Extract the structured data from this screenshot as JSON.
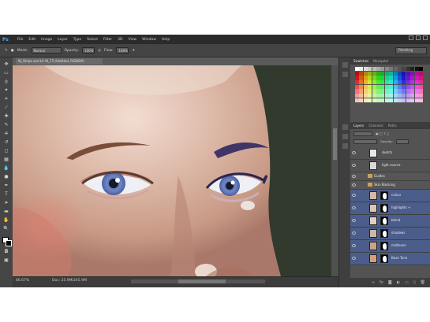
{
  "menubar": {
    "app_logo": "Ps",
    "items": [
      "File",
      "Edit",
      "Image",
      "Layer",
      "Type",
      "Select",
      "Filter",
      "3D",
      "View",
      "Window",
      "Help"
    ]
  },
  "options": {
    "mode_label": "Mode:",
    "mode_value": "Normal",
    "opacity_label": "Opacity:",
    "opacity_value": "100%",
    "flow_label": "Flow:",
    "flow_value": "100%",
    "workspace": "Painting"
  },
  "document": {
    "tab_title": "W_Stripe and Lit W_75 (Untitled, RGB/8#)",
    "zoom": "66.67%",
    "doc_size": "Doc: 25.9M/245.9M"
  },
  "right_panel": {
    "swatch_tabs": [
      "Swatches",
      "Navigator"
    ],
    "layer_tabs": [
      "Layers",
      "Channels",
      "Paths"
    ],
    "kind_label": "Kind",
    "blend_value": "Normal",
    "opacity_label": "Opacity:",
    "opacity_value": "100%",
    "fill_label": "Fill:",
    "fill_value": "100%",
    "layers": [
      {
        "name": "sketch",
        "selected": false,
        "thumb": "#e8e8e8",
        "mask": false
      },
      {
        "name": "light source",
        "selected": false,
        "thumb": "#d9d9d9",
        "mask": false
      }
    ],
    "groups": [
      {
        "name": "Guides"
      },
      {
        "name": "Skin Blocking"
      }
    ],
    "skin_layers": [
      {
        "name": "colour",
        "selected": true,
        "thumb": "#d4b8a8"
      },
      {
        "name": "highlights +",
        "selected": true,
        "thumb": "#d9c6b8"
      },
      {
        "name": "blend",
        "selected": true,
        "thumb": "#e0cfc2"
      },
      {
        "name": "shadows",
        "selected": true,
        "thumb": "#cdb7a5"
      },
      {
        "name": "midtones",
        "selected": true,
        "thumb": "#c9a48c"
      },
      {
        "name": "Base Tone",
        "selected": true,
        "thumb": "#d49f7e"
      }
    ]
  },
  "colors": {
    "app_bg": "#3a3a3a",
    "panel_bg": "#535353",
    "selected_layer": "#4b5d8a",
    "canvas_bg": "#2d3528"
  }
}
